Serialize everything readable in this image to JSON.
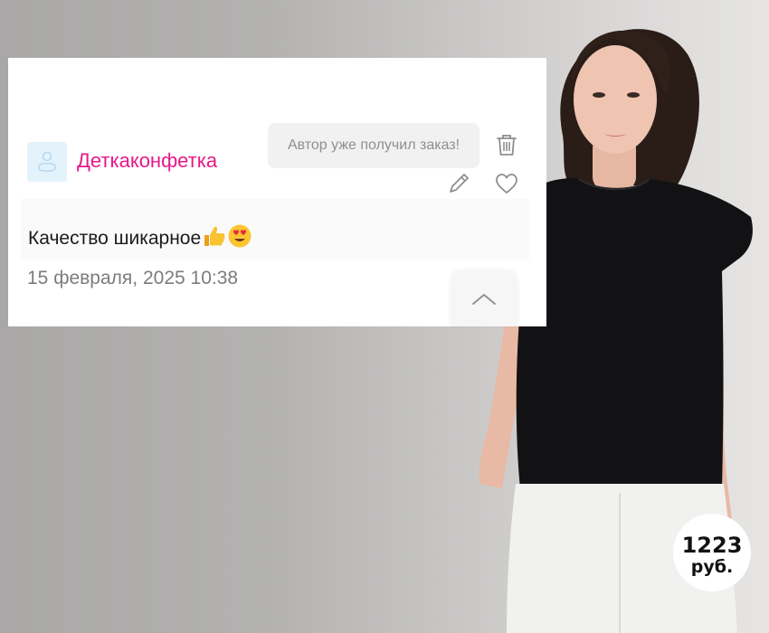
{
  "review": {
    "username": "Деткаконфетка",
    "status_notice": "Автор уже получил заказ!",
    "text": "Качество шикарное",
    "emojis": [
      "thumbs-up-emoji",
      "heart-eyes-emoji"
    ],
    "date": "15 февраля, 2025 10:38"
  },
  "icons": {
    "avatar": "user-avatar-icon",
    "delete": "trash-icon",
    "edit": "pencil-icon",
    "like": "heart-icon",
    "scroll_top": "chevron-up-icon"
  },
  "price_badge": {
    "value": "1223",
    "unit": "руб."
  },
  "colors": {
    "username": "#e6198a",
    "notice_bg": "#f1f1f2",
    "avatar_bg": "#e4f2fc",
    "blouse": "#121214",
    "pants": "#f1f1ef"
  }
}
